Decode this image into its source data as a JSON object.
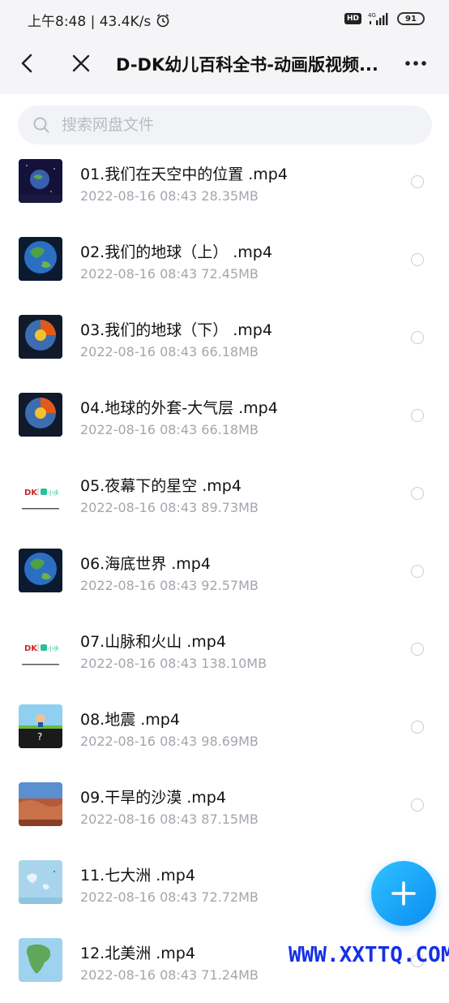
{
  "status_bar": {
    "time_speed": "上午8:48 | 43.4K/s",
    "hd": "HD",
    "network": "4G",
    "battery": "91"
  },
  "title_bar": {
    "title": "D-DK幼儿百科全书-动画版视频..."
  },
  "search": {
    "placeholder": "搜索网盘文件"
  },
  "files": [
    {
      "name": "01.我们在天空中的位置 .mp4",
      "date": "2022-08-16",
      "time": "08:43",
      "size": "28.35MB",
      "thumb": "space-earth"
    },
    {
      "name": "02.我们的地球（上） .mp4",
      "date": "2022-08-16",
      "time": "08:43",
      "size": "72.45MB",
      "thumb": "earth"
    },
    {
      "name": "03.我们的地球（下） .mp4",
      "date": "2022-08-16",
      "time": "08:43",
      "size": "66.18MB",
      "thumb": "earth-core"
    },
    {
      "name": "04.地球的外套-大气层 .mp4",
      "date": "2022-08-16",
      "time": "08:43",
      "size": "66.18MB",
      "thumb": "earth-core"
    },
    {
      "name": "05.夜幕下的星空 .mp4",
      "date": "2022-08-16",
      "time": "08:43",
      "size": "89.73MB",
      "thumb": "dk-logo"
    },
    {
      "name": "06.海底世界 .mp4",
      "date": "2022-08-16",
      "time": "08:43",
      "size": "92.57MB",
      "thumb": "earth"
    },
    {
      "name": "07.山脉和火山 .mp4",
      "date": "2022-08-16",
      "time": "08:43",
      "size": "138.10MB",
      "thumb": "dk-logo"
    },
    {
      "name": "08.地震 .mp4",
      "date": "2022-08-16",
      "time": "08:43",
      "size": "98.69MB",
      "thumb": "cartoon-question"
    },
    {
      "name": "09.干旱的沙漠 .mp4",
      "date": "2022-08-16",
      "time": "08:43",
      "size": "87.15MB",
      "thumb": "desert"
    },
    {
      "name": "11.七大洲 .mp4",
      "date": "2022-08-16",
      "time": "08:43",
      "size": "72.72MB",
      "thumb": "map"
    },
    {
      "name": "12.北美洲 .mp4",
      "date": "2022-08-16",
      "time": "08:43",
      "size": "71.24MB",
      "thumb": "north-america"
    }
  ],
  "fab": {
    "icon": "plus-icon"
  },
  "watermark": "WWW.XXTTQ.COM",
  "colors": {
    "accent": "#0a8cf2",
    "meta_text": "#a3a6ae",
    "watermark": "#1530e6"
  }
}
